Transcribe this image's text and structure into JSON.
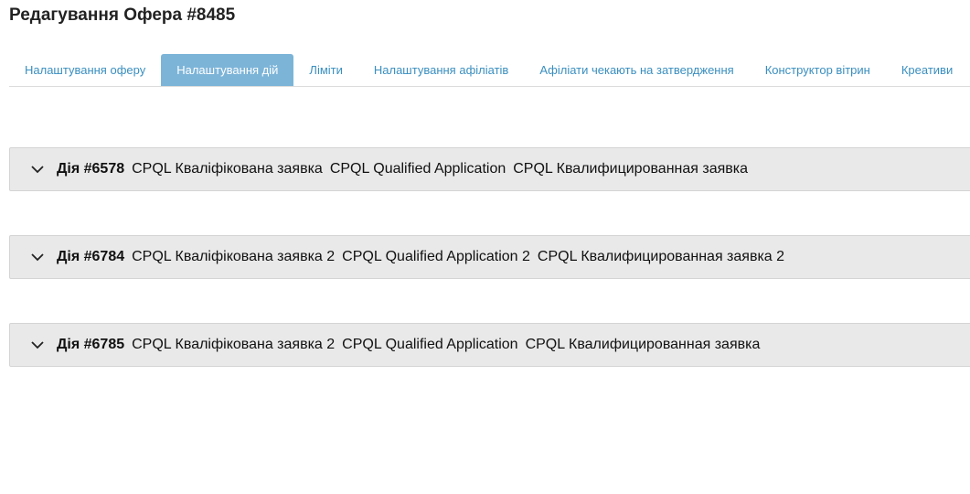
{
  "page": {
    "title": "Редагування Офера #8485"
  },
  "tabs": [
    {
      "label": "Налаштування оферу",
      "active": false
    },
    {
      "label": "Налаштування дій",
      "active": true
    },
    {
      "label": "Ліміти",
      "active": false
    },
    {
      "label": "Налаштування афіліатів",
      "active": false
    },
    {
      "label": "Афіліати чекають на затвердження",
      "active": false
    },
    {
      "label": "Конструктор вітрин",
      "active": false
    },
    {
      "label": "Креативи",
      "active": false
    }
  ],
  "actions": [
    {
      "id_label": "Дія #6578",
      "name_uk": "CPQL Кваліфікована заявка",
      "name_en": "CPQL Qualified Application",
      "name_ru": "CPQL Квалифицированная заявка"
    },
    {
      "id_label": "Дія #6784",
      "name_uk": "CPQL Кваліфікована заявка 2",
      "name_en": "CPQL Qualified Application 2",
      "name_ru": "CPQL Квалифицированная заявка 2"
    },
    {
      "id_label": "Дія #6785",
      "name_uk": "CPQL Кваліфікована заявка 2",
      "name_en": "CPQL Qualified Application",
      "name_ru": "CPQL Квалифицированная заявка"
    }
  ],
  "icons": {
    "accordion_toggle": "chevron-down-icon"
  },
  "colors": {
    "tab_text": "#3a8fc0",
    "tab_active_bg": "#7cb4d8",
    "accordion_bg": "#e9e9e9"
  }
}
